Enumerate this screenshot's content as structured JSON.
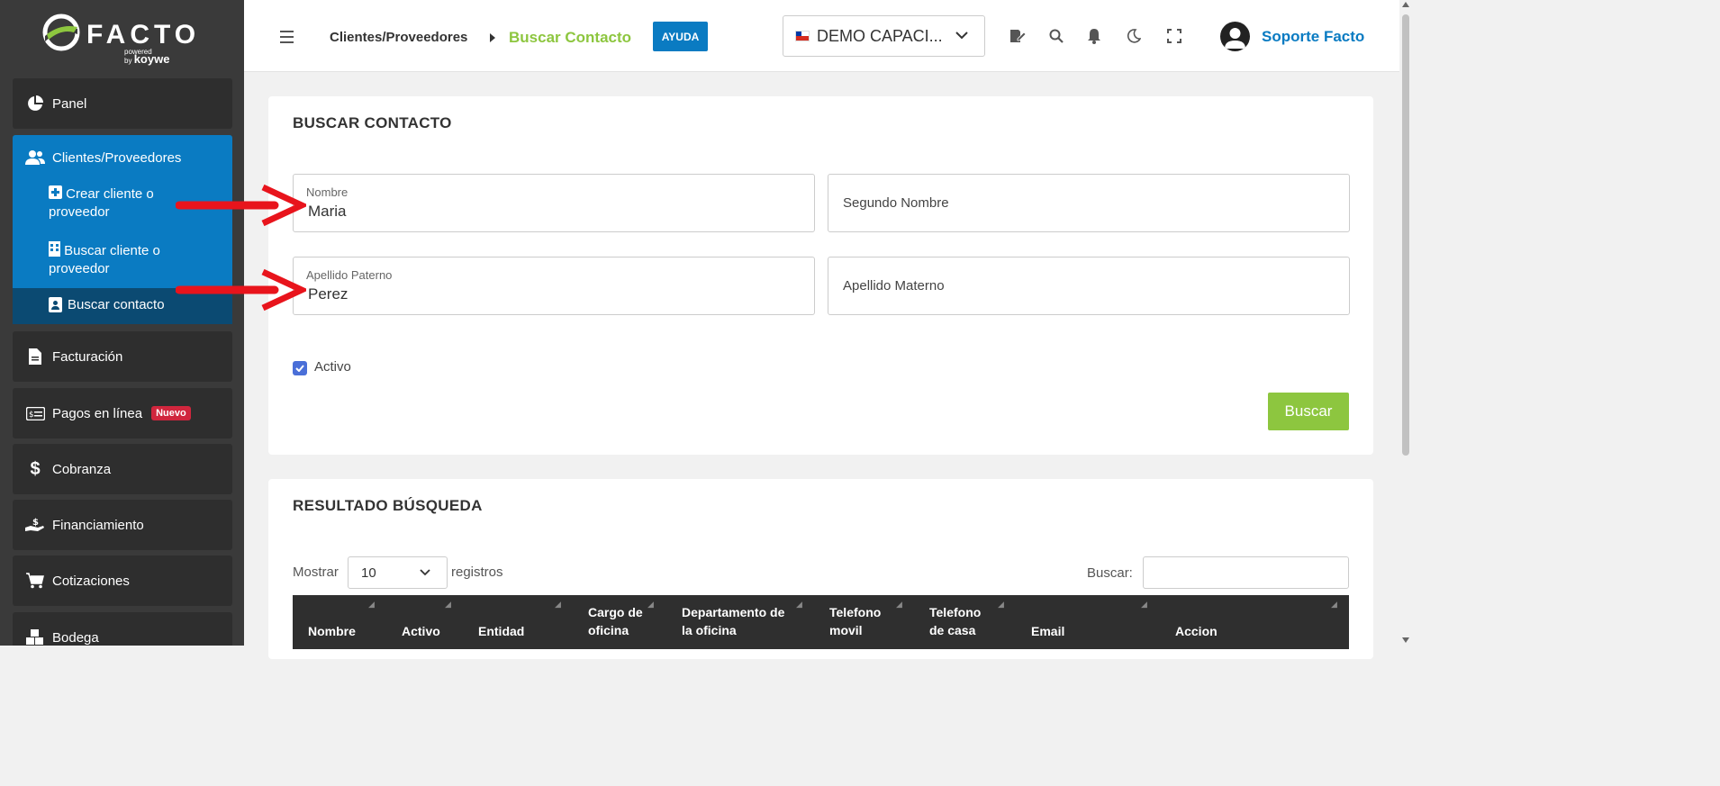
{
  "brand": {
    "name": "FACTO",
    "powered": "powered",
    "by": "by",
    "partner": "koywe"
  },
  "sidebar": {
    "panel": "Panel",
    "clients_group": "Clientes/Proveedores",
    "sub_items": [
      "Crear cliente o proveedor",
      "Buscar cliente o proveedor",
      "Buscar contacto"
    ],
    "items": [
      "Facturación",
      "Pagos en línea",
      "Cobranza",
      "Financiamiento",
      "Cotizaciones",
      "Bodega"
    ],
    "badge": "Nuevo"
  },
  "topbar": {
    "breadcrumb_parent": "Clientes/Proveedores",
    "breadcrumb_current": "Buscar Contacto",
    "help_button": "AYUDA",
    "company": "DEMO CAPACI...",
    "user": "Soporte Facto"
  },
  "search_form": {
    "title": "BUSCAR CONTACTO",
    "nombre_label": "Nombre",
    "nombre_value": "Maria",
    "segundo_nombre_placeholder": "Segundo Nombre",
    "apellido_paterno_label": "Apellido Paterno",
    "apellido_paterno_value": "Perez",
    "apellido_materno_placeholder": "Apellido Materno",
    "activo_label": "Activo",
    "activo_checked": true,
    "search_button": "Buscar"
  },
  "results": {
    "title": "RESULTADO BÚSQUEDA",
    "show_label": "Mostrar",
    "page_length": "10",
    "records_label": "registros",
    "search_label": "Buscar:",
    "columns": [
      "Nombre",
      "Activo",
      "Entidad",
      "Cargo de oficina",
      "Departamento de la oficina",
      "Telefono movil",
      "Telefono de casa",
      "Email",
      "Accion"
    ]
  },
  "colors": {
    "sidebar": "#3a3a3a",
    "accent_blue": "#0a7bc2",
    "accent_green": "#8dc63f",
    "arrow_red": "#e8141c"
  }
}
